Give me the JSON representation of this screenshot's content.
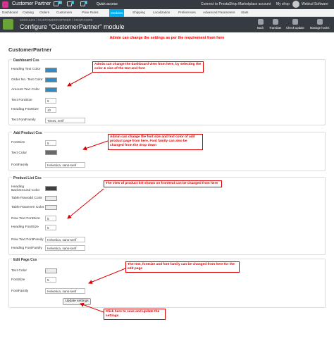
{
  "topbar": {
    "shop_name": "Customer Partner",
    "badges": [
      "21",
      "1",
      "9"
    ],
    "quick_access": "Quick access",
    "connect": "Connect to PrestaShop Marketplace account",
    "my_shop": "My shop",
    "user": "Webkul Software"
  },
  "nav": {
    "items": [
      "Dashboard",
      "Orders",
      "Customers",
      "Price Rules",
      "Modules",
      "Shipping",
      "Localization",
      "Preferences",
      "Advanced Parameters",
      "Stats"
    ],
    "catalog": "Catalog"
  },
  "header": {
    "breadcrumb": [
      "MODULES",
      "CUSTOMERPARTNER",
      "CONFIGURE"
    ],
    "title": "Configure \"CustomerPartner\" module",
    "toolbar": [
      "Back",
      "Translate",
      "Check update",
      "Manage hooks"
    ]
  },
  "header_note": "Admin can change the settings as per the requirement from here",
  "module_title": "CustomerPartner",
  "dashboard_css": {
    "heading": "Dashboard Css",
    "heading_text_color": "Heading Text Color",
    "order_text_color": "Order No. Text Color",
    "amount_text_color": "Amount Text Color",
    "text_fontsize": "Text FontSize",
    "text_fontsize_value": "5",
    "heading_fontsize": "Heading FontSize",
    "heading_fontsize_value": "10",
    "text_fontfamily": "Text FontFamily",
    "text_fontfamily_value": "Times, serif",
    "note": "Admin can change the dashboard view from here, by selecting the color & size of the text and font"
  },
  "add_product_css": {
    "heading": "Add Product Css",
    "fontsize": "FontSize",
    "fontsize_value": "5",
    "text_color": "Text Color",
    "fontfamily": "FontFamily",
    "fontfamily_value": "Helvetica, sans-serif",
    "note": "Admin can change the font size and text color of add product page from here. Font family can also be changed from the drop down"
  },
  "product_list_css": {
    "heading": "Product List Css",
    "heading_bg_color": "Heading BackGround Color",
    "table_rowodd_color": "Table Rowodd Color",
    "table_roweven_color": "Table Roweven Color",
    "row_text_fontsize": "Row Text FontSize",
    "row_text_fontsize_value": "5",
    "heading_fontsize": "Heading FontSize",
    "heading_fontsize_value": "5",
    "row_text_fontfamily": "Row Text FontFamily",
    "row_text_fontfamily_value": "Helvetica, sans-serif",
    "heading_fontfamily": "Heading FontFamily",
    "heading_fontfamily_value": "Helvetica, sans-serif",
    "note": "The view of product list shown on frontend can be changed from here"
  },
  "edit_page_css": {
    "heading": "Edit Page Css",
    "text_color": "Text Color",
    "fontsize": "FontSize",
    "fontsize_value": "5",
    "fontfamily": "FontFamily",
    "fontfamily_value": "Helvetica, sans-serif",
    "note": "The text, fontsize and font family can be changed from here for the edit page"
  },
  "save_button": "Update settings",
  "save_note": "Click here to save and update the settings",
  "colors": {
    "accent": "#00aff0",
    "annotation": "#dd0000",
    "header_bg": "#363a41",
    "module_icon": "#6ba436"
  }
}
